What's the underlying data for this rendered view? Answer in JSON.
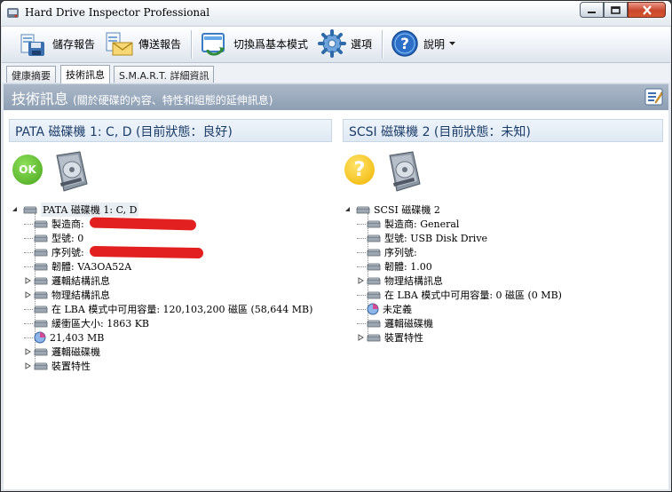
{
  "window": {
    "title": "Hard Drive Inspector Professional"
  },
  "toolbar": {
    "save_report": "儲存報告",
    "send_report": "傳送報告",
    "switch_basic": "切換爲基本模式",
    "options": "選項",
    "help": "說明"
  },
  "tabs": [
    {
      "label": "健康摘要"
    },
    {
      "label": "技術訊息"
    },
    {
      "label": "S.M.A.R.T. 詳細資訊"
    }
  ],
  "banner": {
    "title": "技術訊息",
    "subtitle": "(關於硬碟的內容、特性和組態的延伸訊息)"
  },
  "left": {
    "header": "PATA 磁碟機 1: C, D (目前狀態：良好)",
    "status_badge": "OK",
    "root": "PATA 磁碟機 1: C, D",
    "items": [
      "製造商: ",
      "型號: 0",
      "序列號: ",
      "韌體: VA3OA52A",
      "邏輯結構訊息",
      "物理結構訊息",
      "在 LBA 模式中可用容量: 120,103,200 磁區 (58,644 MB)",
      "緩衝區大小: 1863 KB",
      "21,403 MB",
      "邏輯磁碟機",
      "裝置特性"
    ]
  },
  "right": {
    "header": "SCSI 磁碟機 2 (目前狀態：未知)",
    "status_badge": "?",
    "root": "SCSI 磁碟機 2",
    "items": [
      "製造商: General",
      "型號: USB Disk Drive",
      "序列號: ",
      "韌體: 1.00",
      "物理結構訊息",
      "在 LBA 模式中可用容量: 0 磁區 (0 MB)",
      "未定義",
      "邏輯磁碟機",
      "裝置特性"
    ]
  },
  "colors": {
    "ok_green": "#5dbb2a",
    "unknown_yellow": "#f5c20a",
    "banner": "#9aaabd",
    "redaction": "#e32020"
  }
}
